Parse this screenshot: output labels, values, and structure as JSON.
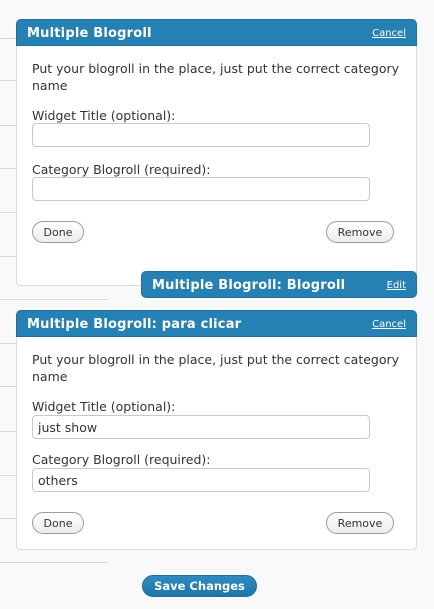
{
  "widget1": {
    "title": "Multiple Blogroll",
    "action": "Cancel",
    "description": "Put your blogroll in the place, just put the correct category name",
    "title_label": "Widget Title (optional):",
    "title_value": "",
    "category_label": "Category Blogroll (required):",
    "category_value": "",
    "done_label": "Done",
    "remove_label": "Remove"
  },
  "widget2": {
    "title": "Multiple Blogroll: Blogroll",
    "action": "Edit"
  },
  "widget3": {
    "title": "Multiple Blogroll: para clicar",
    "action": "Cancel",
    "description": "Put your blogroll in the place, just put the correct category name",
    "title_label": "Widget Title (optional):",
    "title_value": "just show",
    "category_label": "Category Blogroll (required):",
    "category_value": "others",
    "done_label": "Done",
    "remove_label": "Remove"
  },
  "save_label": "Save Changes"
}
